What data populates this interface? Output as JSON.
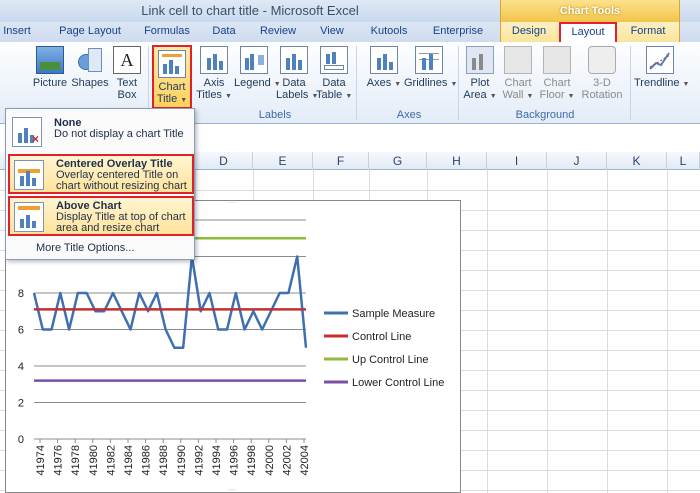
{
  "window": {
    "title": "Link cell to chart title  -  Microsoft Excel"
  },
  "contextual": {
    "header": "Chart Tools"
  },
  "tabs": [
    {
      "label": "Insert"
    },
    {
      "label": "Page Layout"
    },
    {
      "label": "Formulas"
    },
    {
      "label": "Data"
    },
    {
      "label": "Review"
    },
    {
      "label": "View"
    },
    {
      "label": "Kutools"
    },
    {
      "label": "Enterprise"
    },
    {
      "label": "Design"
    },
    {
      "label": "Layout"
    },
    {
      "label": "Format"
    }
  ],
  "ribbon": {
    "picture": {
      "l1": "Picture"
    },
    "shapes": {
      "l1": "Shapes"
    },
    "textbox": {
      "l1": "Text",
      "l2": "Box"
    },
    "chart_title": {
      "l1": "Chart",
      "l2": "Title"
    },
    "axis_titles": {
      "l1": "Axis",
      "l2": "Titles"
    },
    "legend": {
      "l1": "Legend"
    },
    "data_labels": {
      "l1": "Data",
      "l2": "Labels"
    },
    "data_table": {
      "l1": "Data",
      "l2": "Table"
    },
    "axes": {
      "l1": "Axes"
    },
    "gridlines": {
      "l1": "Gridlines"
    },
    "plot_area": {
      "l1": "Plot",
      "l2": "Area"
    },
    "chart_wall": {
      "l1": "Chart",
      "l2": "Wall"
    },
    "chart_floor": {
      "l1": "Chart",
      "l2": "Floor"
    },
    "rotation": {
      "l1": "3-D",
      "l2": "Rotation"
    },
    "trendline": {
      "l1": "Trendline"
    },
    "groups": {
      "labels": "Labels",
      "axes": "Axes",
      "background": "Background"
    }
  },
  "dropdown": {
    "none": {
      "title": "None",
      "desc": "Do not display a chart Title"
    },
    "centered": {
      "title": "Centered Overlay Title",
      "desc": "Overlay centered Title on chart without resizing chart"
    },
    "above": {
      "title": "Above Chart",
      "desc": "Display Title at top of chart area and resize chart"
    },
    "more": "More Title Options..."
  },
  "columns": [
    "D",
    "E",
    "F",
    "G",
    "H",
    "I",
    "J",
    "K",
    "L"
  ],
  "colors": {
    "sample": "#3e6fb0",
    "control": "#c0302f",
    "up": "#8cbd3a",
    "lower": "#7a4fa6"
  },
  "chart_data": {
    "type": "line",
    "ylim": [
      0,
      12
    ],
    "yticks": [
      "0",
      "2",
      "4",
      "6",
      "8"
    ],
    "x": [
      "41974",
      "41976",
      "41978",
      "41980",
      "41982",
      "41984",
      "41986",
      "41988",
      "41990",
      "41992",
      "41994",
      "41996",
      "41998",
      "42000",
      "42002",
      "42004"
    ],
    "series": [
      {
        "name": "Sample Measure",
        "values": [
          8,
          6,
          6,
          8,
          6,
          8,
          8,
          7,
          7,
          8,
          7,
          6,
          8,
          7,
          8,
          6,
          5,
          5,
          10,
          7,
          8,
          6,
          6,
          8,
          6,
          7,
          6,
          7,
          8,
          8,
          10,
          5
        ]
      },
      {
        "name": "Control Line",
        "values": [
          7.1
        ]
      },
      {
        "name": "Up Control Line",
        "values": [
          11
        ]
      },
      {
        "name": "Lower Control Line",
        "values": [
          3.2
        ]
      }
    ]
  }
}
